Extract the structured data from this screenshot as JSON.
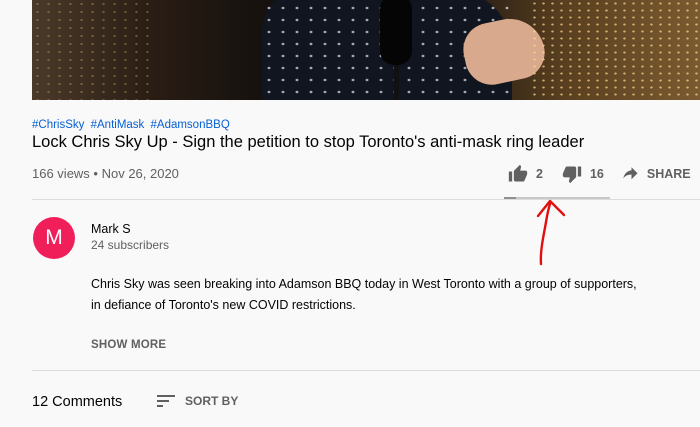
{
  "video": {
    "hashtags": [
      "#ChrisSky",
      "#AntiMask",
      "#AdamsonBBQ"
    ],
    "title": "Lock Chris Sky Up - Sign the petition to stop Toronto's anti-mask ring leader",
    "meta": "166 views • Nov 26, 2020",
    "likes": "2",
    "dislikes": "16",
    "share_label": "SHARE",
    "like_ratio": 0.11
  },
  "channel": {
    "avatar_letter": "M",
    "name": "Mark S",
    "subscribers": "24 subscribers"
  },
  "description": {
    "lines": [
      "Chris Sky was seen breaking into Adamson BBQ today in West Toronto with a group of supporters,",
      "in defiance of Toronto's new COVID restrictions."
    ],
    "show_more": "SHOW MORE"
  },
  "comments": {
    "count": "12 Comments",
    "sort_label": "SORT BY"
  },
  "colors": {
    "avatar": "#f01f5a",
    "hashtag": "#065fd4",
    "annotation_arrow": "#e01010"
  }
}
